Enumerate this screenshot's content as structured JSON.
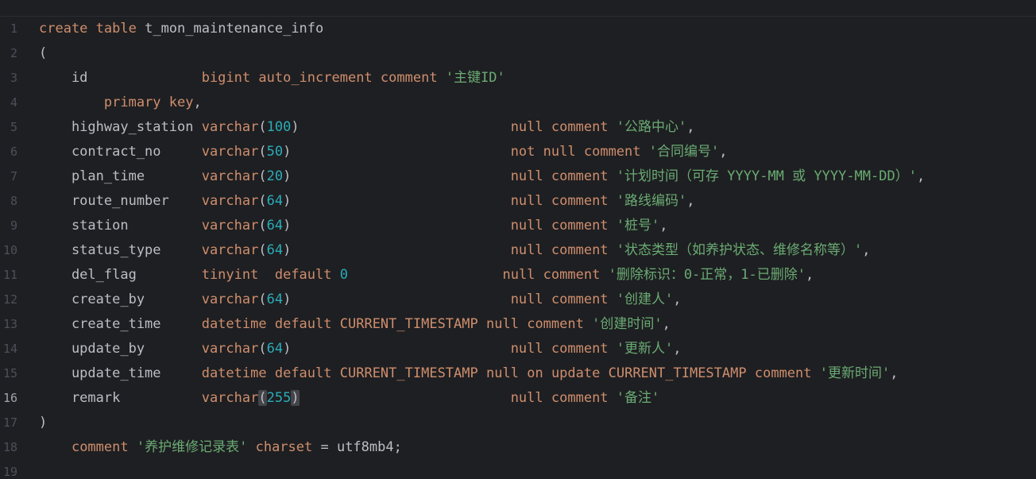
{
  "editor": {
    "current_line": 16,
    "line_numbers": [
      "1",
      "2",
      "3",
      "4",
      "5",
      "6",
      "7",
      "8",
      "9",
      "10",
      "11",
      "12",
      "13",
      "14",
      "15",
      "16",
      "17",
      "18",
      "19"
    ],
    "lines": [
      [
        {
          "t": "kw",
          "v": "create"
        },
        {
          "t": "ident",
          "v": " "
        },
        {
          "t": "kw",
          "v": "table"
        },
        {
          "t": "ident",
          "v": " t_mon_maintenance_info"
        }
      ],
      [
        {
          "t": "punct",
          "v": "("
        }
      ],
      [
        {
          "t": "ident",
          "v": "    id              "
        },
        {
          "t": "kw",
          "v": "bigint"
        },
        {
          "t": "ident",
          "v": " "
        },
        {
          "t": "kw",
          "v": "auto_increment"
        },
        {
          "t": "ident",
          "v": " "
        },
        {
          "t": "kw",
          "v": "comment"
        },
        {
          "t": "ident",
          "v": " "
        },
        {
          "t": "str",
          "v": "'主键ID'"
        }
      ],
      [
        {
          "t": "ident",
          "v": "        "
        },
        {
          "t": "kw",
          "v": "primary"
        },
        {
          "t": "ident",
          "v": " "
        },
        {
          "t": "kw",
          "v": "key"
        },
        {
          "t": "punct",
          "v": ","
        }
      ],
      [
        {
          "t": "ident",
          "v": "    highway_station "
        },
        {
          "t": "kw",
          "v": "varchar"
        },
        {
          "t": "punct",
          "v": "("
        },
        {
          "t": "num",
          "v": "100"
        },
        {
          "t": "punct",
          "v": ")"
        },
        {
          "t": "ident",
          "v": "                          "
        },
        {
          "t": "kw",
          "v": "null"
        },
        {
          "t": "ident",
          "v": " "
        },
        {
          "t": "kw",
          "v": "comment"
        },
        {
          "t": "ident",
          "v": " "
        },
        {
          "t": "str",
          "v": "'公路中心'"
        },
        {
          "t": "punct",
          "v": ","
        }
      ],
      [
        {
          "t": "ident",
          "v": "    contract_no     "
        },
        {
          "t": "kw",
          "v": "varchar"
        },
        {
          "t": "punct",
          "v": "("
        },
        {
          "t": "num",
          "v": "50"
        },
        {
          "t": "punct",
          "v": ")"
        },
        {
          "t": "ident",
          "v": "                           "
        },
        {
          "t": "kw",
          "v": "not"
        },
        {
          "t": "ident",
          "v": " "
        },
        {
          "t": "kw",
          "v": "null"
        },
        {
          "t": "ident",
          "v": " "
        },
        {
          "t": "kw",
          "v": "comment"
        },
        {
          "t": "ident",
          "v": " "
        },
        {
          "t": "str",
          "v": "'合同编号'"
        },
        {
          "t": "punct",
          "v": ","
        }
      ],
      [
        {
          "t": "ident",
          "v": "    plan_time       "
        },
        {
          "t": "kw",
          "v": "varchar"
        },
        {
          "t": "punct",
          "v": "("
        },
        {
          "t": "num",
          "v": "20"
        },
        {
          "t": "punct",
          "v": ")"
        },
        {
          "t": "ident",
          "v": "                           "
        },
        {
          "t": "kw",
          "v": "null"
        },
        {
          "t": "ident",
          "v": " "
        },
        {
          "t": "kw",
          "v": "comment"
        },
        {
          "t": "ident",
          "v": " "
        },
        {
          "t": "str",
          "v": "'计划时间（可存 YYYY-MM 或 YYYY-MM-DD）'"
        },
        {
          "t": "punct",
          "v": ","
        }
      ],
      [
        {
          "t": "ident",
          "v": "    route_number    "
        },
        {
          "t": "kw",
          "v": "varchar"
        },
        {
          "t": "punct",
          "v": "("
        },
        {
          "t": "num",
          "v": "64"
        },
        {
          "t": "punct",
          "v": ")"
        },
        {
          "t": "ident",
          "v": "                           "
        },
        {
          "t": "kw",
          "v": "null"
        },
        {
          "t": "ident",
          "v": " "
        },
        {
          "t": "kw",
          "v": "comment"
        },
        {
          "t": "ident",
          "v": " "
        },
        {
          "t": "str",
          "v": "'路线编码'"
        },
        {
          "t": "punct",
          "v": ","
        }
      ],
      [
        {
          "t": "ident",
          "v": "    station         "
        },
        {
          "t": "kw",
          "v": "varchar"
        },
        {
          "t": "punct",
          "v": "("
        },
        {
          "t": "num",
          "v": "64"
        },
        {
          "t": "punct",
          "v": ")"
        },
        {
          "t": "ident",
          "v": "                           "
        },
        {
          "t": "kw",
          "v": "null"
        },
        {
          "t": "ident",
          "v": " "
        },
        {
          "t": "kw",
          "v": "comment"
        },
        {
          "t": "ident",
          "v": " "
        },
        {
          "t": "str",
          "v": "'桩号'"
        },
        {
          "t": "punct",
          "v": ","
        }
      ],
      [
        {
          "t": "ident",
          "v": "    status_type     "
        },
        {
          "t": "kw",
          "v": "varchar"
        },
        {
          "t": "punct",
          "v": "("
        },
        {
          "t": "num",
          "v": "64"
        },
        {
          "t": "punct",
          "v": ")"
        },
        {
          "t": "ident",
          "v": "                           "
        },
        {
          "t": "kw",
          "v": "null"
        },
        {
          "t": "ident",
          "v": " "
        },
        {
          "t": "kw",
          "v": "comment"
        },
        {
          "t": "ident",
          "v": " "
        },
        {
          "t": "str",
          "v": "'状态类型（如养护状态、维修名称等）'"
        },
        {
          "t": "punct",
          "v": ","
        }
      ],
      [
        {
          "t": "ident",
          "v": "    del_flag        "
        },
        {
          "t": "kw",
          "v": "tinyint"
        },
        {
          "t": "ident",
          "v": "  "
        },
        {
          "t": "kw",
          "v": "default"
        },
        {
          "t": "ident",
          "v": " "
        },
        {
          "t": "num",
          "v": "0"
        },
        {
          "t": "ident",
          "v": "                   "
        },
        {
          "t": "kw",
          "v": "null"
        },
        {
          "t": "ident",
          "v": " "
        },
        {
          "t": "kw",
          "v": "comment"
        },
        {
          "t": "ident",
          "v": " "
        },
        {
          "t": "str",
          "v": "'删除标识：0-正常，1-已删除'"
        },
        {
          "t": "punct",
          "v": ","
        }
      ],
      [
        {
          "t": "ident",
          "v": "    create_by       "
        },
        {
          "t": "kw",
          "v": "varchar"
        },
        {
          "t": "punct",
          "v": "("
        },
        {
          "t": "num",
          "v": "64"
        },
        {
          "t": "punct",
          "v": ")"
        },
        {
          "t": "ident",
          "v": "                           "
        },
        {
          "t": "kw",
          "v": "null"
        },
        {
          "t": "ident",
          "v": " "
        },
        {
          "t": "kw",
          "v": "comment"
        },
        {
          "t": "ident",
          "v": " "
        },
        {
          "t": "str",
          "v": "'创建人'"
        },
        {
          "t": "punct",
          "v": ","
        }
      ],
      [
        {
          "t": "ident",
          "v": "    create_time     "
        },
        {
          "t": "kw",
          "v": "datetime"
        },
        {
          "t": "ident",
          "v": " "
        },
        {
          "t": "kw",
          "v": "default"
        },
        {
          "t": "ident",
          "v": " "
        },
        {
          "t": "kw",
          "v": "CURRENT_TIMESTAMP"
        },
        {
          "t": "ident",
          "v": " "
        },
        {
          "t": "kw",
          "v": "null"
        },
        {
          "t": "ident",
          "v": " "
        },
        {
          "t": "kw",
          "v": "comment"
        },
        {
          "t": "ident",
          "v": " "
        },
        {
          "t": "str",
          "v": "'创建时间'"
        },
        {
          "t": "punct",
          "v": ","
        }
      ],
      [
        {
          "t": "ident",
          "v": "    update_by       "
        },
        {
          "t": "kw",
          "v": "varchar"
        },
        {
          "t": "punct",
          "v": "("
        },
        {
          "t": "num",
          "v": "64"
        },
        {
          "t": "punct",
          "v": ")"
        },
        {
          "t": "ident",
          "v": "                           "
        },
        {
          "t": "kw",
          "v": "null"
        },
        {
          "t": "ident",
          "v": " "
        },
        {
          "t": "kw",
          "v": "comment"
        },
        {
          "t": "ident",
          "v": " "
        },
        {
          "t": "str",
          "v": "'更新人'"
        },
        {
          "t": "punct",
          "v": ","
        }
      ],
      [
        {
          "t": "ident",
          "v": "    update_time     "
        },
        {
          "t": "kw",
          "v": "datetime"
        },
        {
          "t": "ident",
          "v": " "
        },
        {
          "t": "kw",
          "v": "default"
        },
        {
          "t": "ident",
          "v": " "
        },
        {
          "t": "kw",
          "v": "CURRENT_TIMESTAMP"
        },
        {
          "t": "ident",
          "v": " "
        },
        {
          "t": "kw",
          "v": "null"
        },
        {
          "t": "ident",
          "v": " "
        },
        {
          "t": "kw",
          "v": "on"
        },
        {
          "t": "ident",
          "v": " "
        },
        {
          "t": "kw",
          "v": "update"
        },
        {
          "t": "ident",
          "v": " "
        },
        {
          "t": "kw",
          "v": "CURRENT_TIMESTAMP"
        },
        {
          "t": "ident",
          "v": " "
        },
        {
          "t": "kw",
          "v": "comment"
        },
        {
          "t": "ident",
          "v": " "
        },
        {
          "t": "str",
          "v": "'更新时间'"
        },
        {
          "t": "punct",
          "v": ","
        }
      ],
      [
        {
          "t": "ident",
          "v": "    remark          "
        },
        {
          "t": "kw",
          "v": "varchar"
        },
        {
          "t": "punct-m",
          "v": "("
        },
        {
          "t": "num",
          "v": "255"
        },
        {
          "t": "punct-m",
          "v": ")"
        },
        {
          "t": "ident",
          "v": "                          "
        },
        {
          "t": "kw",
          "v": "null"
        },
        {
          "t": "ident",
          "v": " "
        },
        {
          "t": "kw",
          "v": "comment"
        },
        {
          "t": "ident",
          "v": " "
        },
        {
          "t": "str",
          "v": "'备注'"
        }
      ],
      [
        {
          "t": "punct",
          "v": ")"
        }
      ],
      [
        {
          "t": "ident",
          "v": "    "
        },
        {
          "t": "kw",
          "v": "comment"
        },
        {
          "t": "ident",
          "v": " "
        },
        {
          "t": "str",
          "v": "'养护维修记录表'"
        },
        {
          "t": "ident",
          "v": " "
        },
        {
          "t": "kw",
          "v": "charset"
        },
        {
          "t": "ident",
          "v": " = utf8mb4;"
        }
      ],
      []
    ]
  }
}
